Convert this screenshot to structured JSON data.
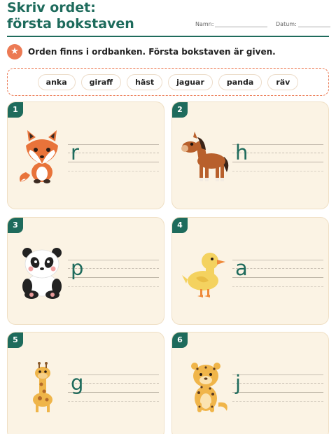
{
  "header": {
    "title": "Skriv ordet: första bokstaven",
    "name_label": "Namn:",
    "date_label": "Datum:"
  },
  "instruction": {
    "icon": "star-icon",
    "text": "Orden finns i ordbanken. Första bokstaven är given."
  },
  "word_bank": [
    "anka",
    "giraff",
    "häst",
    "jaguar",
    "panda",
    "räv"
  ],
  "colors": {
    "accent": "#1e6b5c",
    "orange": "#ec7a54",
    "card_bg": "#fbf3e4"
  },
  "cards": [
    {
      "number": "1",
      "animal": "fox",
      "letter": "r"
    },
    {
      "number": "2",
      "animal": "horse",
      "letter": "h"
    },
    {
      "number": "3",
      "animal": "panda",
      "letter": "p"
    },
    {
      "number": "4",
      "animal": "duck",
      "letter": "a"
    },
    {
      "number": "5",
      "animal": "giraffe",
      "letter": "g"
    },
    {
      "number": "6",
      "animal": "jaguar",
      "letter": "j"
    }
  ]
}
